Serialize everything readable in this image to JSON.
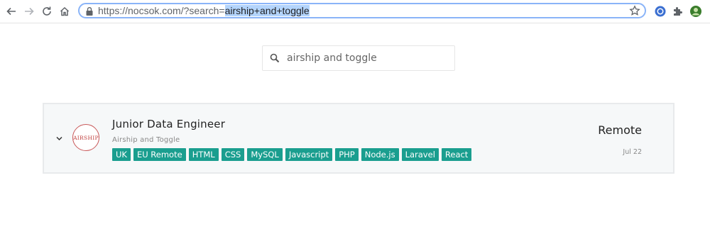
{
  "browser": {
    "url_base": "https://nocsok.com/?search=",
    "url_query": "airship+and+toggle"
  },
  "search": {
    "value": "airship and toggle",
    "placeholder": ""
  },
  "job": {
    "title": "Junior Data Engineer",
    "company": "Airship and Toggle",
    "logo_text": "AIRSHIP",
    "location": "Remote",
    "date": "Jul 22",
    "tags": [
      "UK",
      "EU Remote",
      "HTML",
      "CSS",
      "MySQL",
      "Javascript",
      "PHP",
      "Node.js",
      "Laravel",
      "React"
    ]
  },
  "colors": {
    "tag_bg": "#1a9e8f",
    "omnibox_focus": "#8ab4f8"
  }
}
